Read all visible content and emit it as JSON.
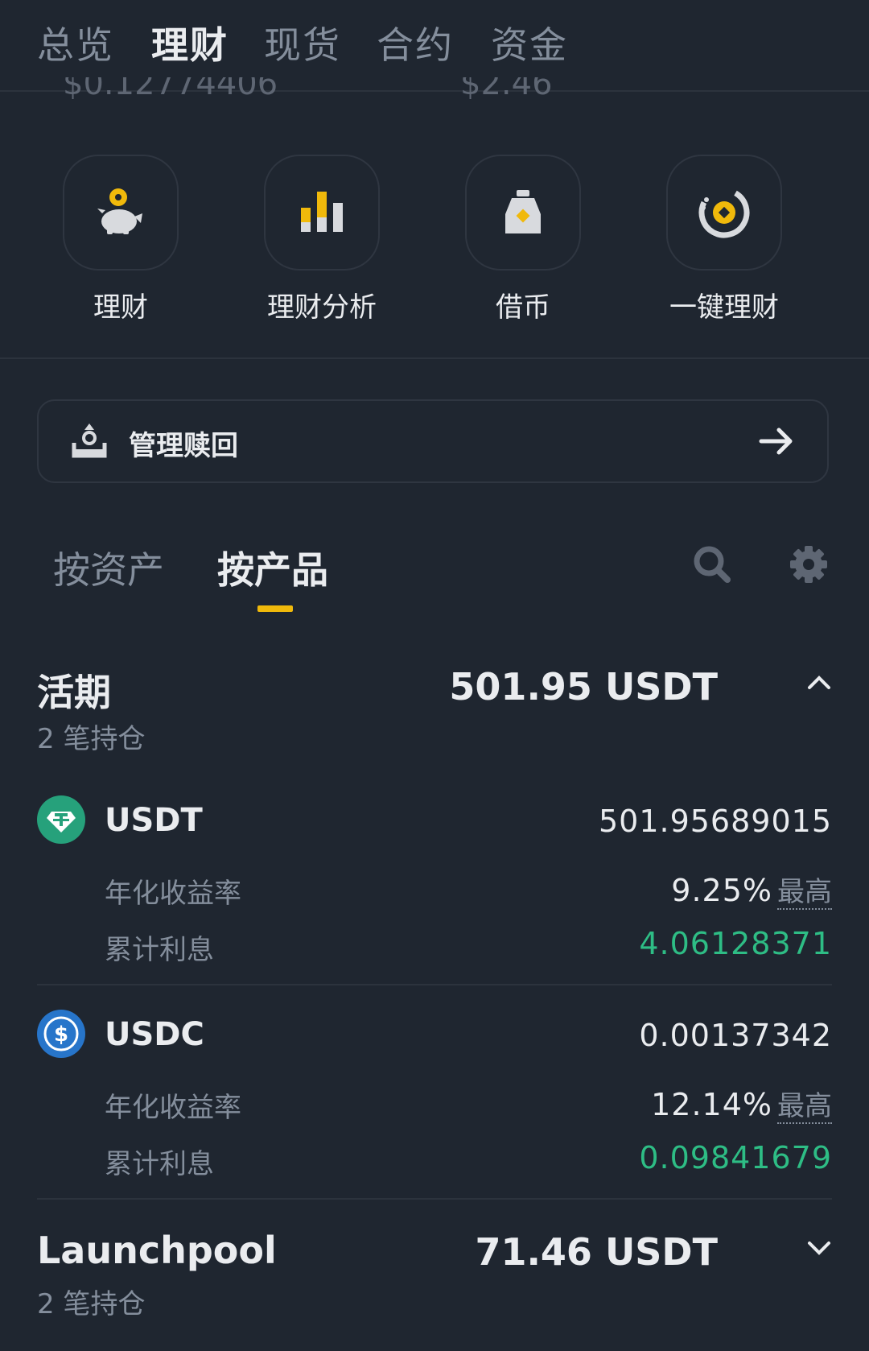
{
  "top_tabs": [
    "总览",
    "理财",
    "现货",
    "合约",
    "资金"
  ],
  "peek": {
    "left": "$0.12774406",
    "right": "$2.46"
  },
  "quick_actions": [
    {
      "label": "理财",
      "icon": "piggy-bank-icon"
    },
    {
      "label": "理财分析",
      "icon": "bar-chart-icon"
    },
    {
      "label": "借币",
      "icon": "loan-bag-icon"
    },
    {
      "label": "一键理财",
      "icon": "auto-invest-icon"
    }
  ],
  "redeem": {
    "label": "管理赎回"
  },
  "sub_tabs": [
    "按资产",
    "按产品"
  ],
  "groups": {
    "flexible": {
      "title": "活期",
      "positions": "2 笔持仓",
      "total": "501.95 USDT"
    },
    "launchpool": {
      "title": "Launchpool",
      "positions": "2 笔持仓",
      "total": "71.46 USDT"
    }
  },
  "holdings": [
    {
      "coin": "USDT",
      "amount": "501.95689015",
      "apr_label": "年化收益率",
      "apr": "9.25%",
      "apr_badge": "最高",
      "interest_label": "累计利息",
      "interest": "4.06128371"
    },
    {
      "coin": "USDC",
      "amount": "0.00137342",
      "apr_label": "年化收益率",
      "apr": "12.14%",
      "apr_badge": "最高",
      "interest_label": "累计利息",
      "interest": "0.09841679"
    }
  ],
  "colors": {
    "bg": "#1f2630",
    "accent": "#f0b90b",
    "green": "#2ebd85",
    "muted": "#848e9c",
    "usdt": "#26a17b",
    "usdc": "#2775ca"
  }
}
